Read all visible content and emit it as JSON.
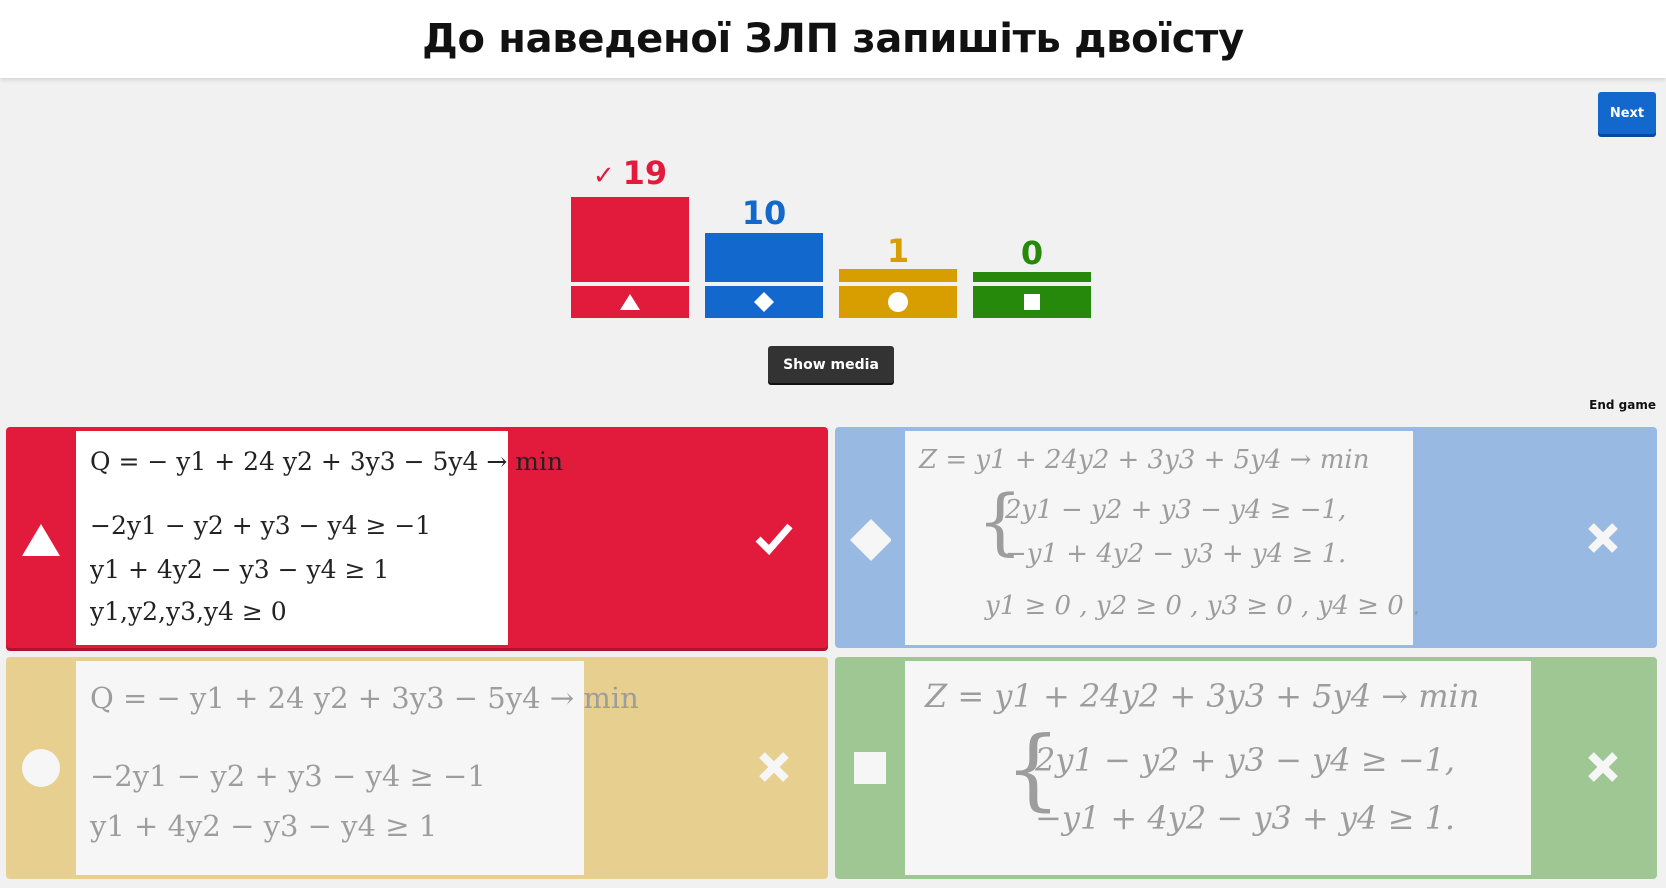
{
  "header": {
    "title": "До наведеної ЗЛП запишіть двоїсту"
  },
  "controls": {
    "next_label": "Next",
    "show_media_label": "Show media",
    "end_game_label": "End game"
  },
  "colors": {
    "red": "#e21b3c",
    "blue": "#1368ce",
    "yellow": "#d89e00",
    "green": "#26890c"
  },
  "results": [
    {
      "shape": "triangle-icon",
      "count": "19",
      "correct": true,
      "correct_mark": "✓"
    },
    {
      "shape": "diamond-icon",
      "count": "10",
      "correct": false
    },
    {
      "shape": "circle-icon",
      "count": "1",
      "correct": false
    },
    {
      "shape": "square-icon",
      "count": "0",
      "correct": false
    }
  ],
  "answers": [
    {
      "shape": "triangle-icon",
      "status": "correct",
      "lines": [
        "Q = − y1 + 24 y2 + 3y3 − 5y4 → min",
        "−2y1 − y2 + y3 − y4 ≥ −1",
        "y1 + 4y2 − y3 − y4 ≥ 1",
        "y1,y2,y3,y4 ≥ 0"
      ]
    },
    {
      "shape": "diamond-icon",
      "status": "incorrect",
      "lines": [
        "Z = y1 + 24y2 + 3y3 + 5y4 → min",
        "2y1 − y2 + y3 − y4 ≥ −1,",
        "−y1 + 4y2 − y3 + y4 ≥ 1.",
        "y1 ≥ 0 , y2 ≥ 0 , y3 ≥ 0 , y4 ≥ 0 ."
      ]
    },
    {
      "shape": "circle-icon",
      "status": "incorrect",
      "lines": [
        "Q = − y1 + 24 y2 + 3y3 − 5y4 → min",
        "−2y1 − y2 + y3 − y4 ≥ −1",
        "y1 + 4y2 − y3 − y4 ≥ 1"
      ]
    },
    {
      "shape": "square-icon",
      "status": "incorrect",
      "lines": [
        "Z = y1 + 24y2 + 3y3 + 5y4 → min",
        "2y1 − y2 + y3 − y4 ≥ −1,",
        "−y1 + 4y2 − y3 + y4 ≥ 1."
      ]
    }
  ]
}
